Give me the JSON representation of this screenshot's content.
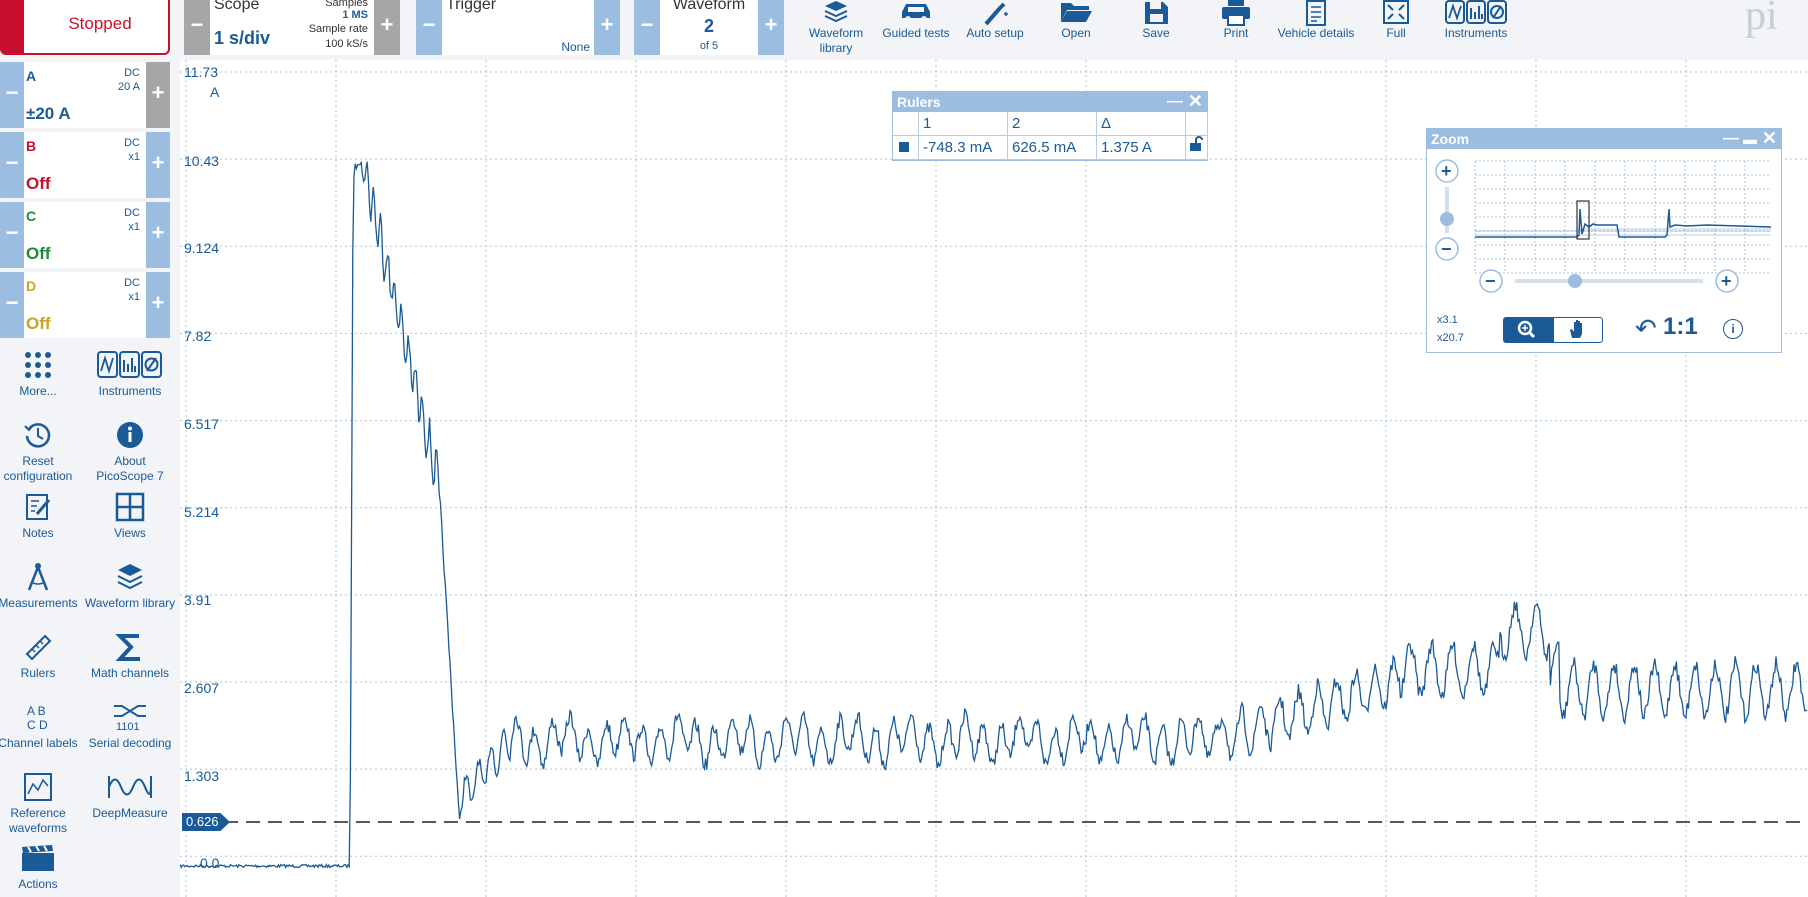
{
  "status": {
    "label": "Stopped"
  },
  "scope": {
    "title": "Scope",
    "timebase": "1 s/div",
    "samples_label": "Samples",
    "samples_value": "1 MS",
    "rate_label": "Sample rate",
    "rate_value": "100 kS/s"
  },
  "trigger": {
    "title": "Trigger",
    "mode": "None"
  },
  "waveform": {
    "title": "Waveform",
    "current": "2",
    "of": "of 5"
  },
  "toolbar": [
    {
      "label": "Waveform library",
      "icon": "waveform-library-icon"
    },
    {
      "label": "Guided tests",
      "icon": "car-icon"
    },
    {
      "label": "Auto setup",
      "icon": "magic-wand-icon"
    },
    {
      "label": "Open",
      "icon": "folder-open-icon"
    },
    {
      "label": "Save",
      "icon": "floppy-disk-icon"
    },
    {
      "label": "Print",
      "icon": "printer-icon"
    },
    {
      "label": "Vehicle details",
      "icon": "checklist-icon"
    },
    {
      "label": "Full",
      "icon": "fullscreen-icon"
    },
    {
      "label": "Instruments",
      "icon": "instruments-icon"
    }
  ],
  "brand_text": "pi",
  "channels": [
    {
      "name": "A",
      "coupling": "DC",
      "probe": "20 A",
      "value": "±20 A",
      "color": "#1a5a96"
    },
    {
      "name": "B",
      "coupling": "DC",
      "probe": "x1",
      "value": "Off",
      "color": "#c8102e"
    },
    {
      "name": "C",
      "coupling": "DC",
      "probe": "x1",
      "value": "Off",
      "color": "#1b8a3a"
    },
    {
      "name": "D",
      "coupling": "DC",
      "probe": "x1",
      "value": "Off",
      "color": "#c9a227"
    }
  ],
  "tools": [
    {
      "label": "More...",
      "icon": "dots-grid-icon"
    },
    {
      "label": "Instruments",
      "icon": "instruments-icon"
    },
    {
      "label": "Reset configuration",
      "icon": "reset-clock-icon"
    },
    {
      "label": "About PicoScope 7",
      "icon": "info-icon"
    },
    {
      "label": "Notes",
      "icon": "notes-icon"
    },
    {
      "label": "Views",
      "icon": "views-grid-icon"
    },
    {
      "label": "Measurements",
      "icon": "compass-icon"
    },
    {
      "label": "Waveform library",
      "icon": "waveform-library-icon"
    },
    {
      "label": "Rulers",
      "icon": "ruler-icon"
    },
    {
      "label": "Math channels",
      "icon": "sigma-icon"
    },
    {
      "label": "Channel labels",
      "icon": "abcd-icon"
    },
    {
      "label": "Serial decoding",
      "icon": "serial-decoding-icon"
    },
    {
      "label": "Reference waveforms",
      "icon": "reference-waveform-icon"
    },
    {
      "label": "DeepMeasure",
      "icon": "deepmeasure-icon"
    },
    {
      "label": "Actions",
      "icon": "clapperboard-icon"
    }
  ],
  "serial_digits": "1101",
  "graph": {
    "y_unit": "A",
    "y_ticks": [
      "11.73",
      "10.43",
      "9.124",
      "7.82",
      "6.517",
      "5.214",
      "3.91",
      "2.607",
      "1.303",
      "0.0"
    ],
    "ruler_marker": "0.626",
    "trace_color": "#1a5a96"
  },
  "rulers": {
    "title": "Rulers",
    "headers": [
      "1",
      "2",
      "Δ"
    ],
    "values": [
      "-748.3 mA",
      "626.5 mA",
      "1.375 A"
    ]
  },
  "zoom": {
    "title": "Zoom",
    "x_factor": "x3.1",
    "y_factor": "x20.7",
    "ratio": "1:1"
  }
}
